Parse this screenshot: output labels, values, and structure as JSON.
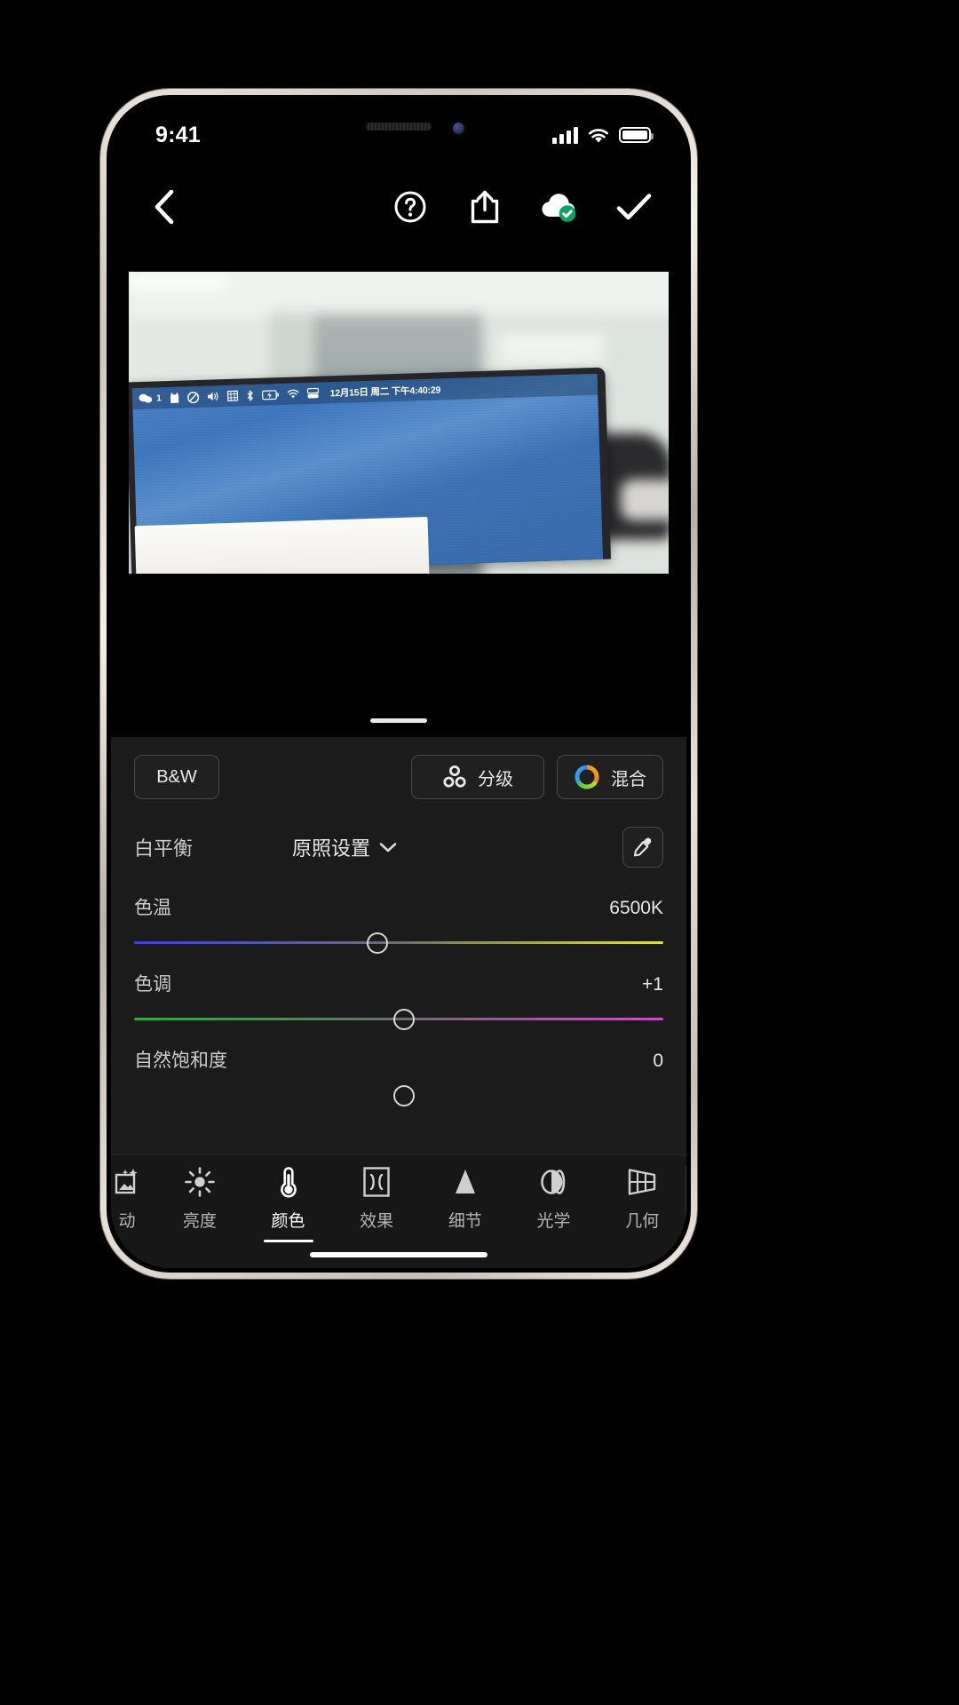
{
  "status_bar": {
    "time": "9:41",
    "signal_icon": "cellular-signal-icon",
    "wifi_icon": "wifi-icon",
    "battery_icon": "battery-icon"
  },
  "nav_bar": {
    "back_icon": "chevron-left-icon",
    "help_icon": "question-circle-icon",
    "share_icon": "share-upload-icon",
    "cloud_icon": "cloud-synced-icon",
    "done_icon": "checkmark-icon"
  },
  "photo": {
    "mac_menubar": {
      "wechat_badge": "1",
      "items": [
        "wechat-icon",
        "cat-icon",
        "display-icon",
        "volume-icon",
        "input-method-pinyin-icon",
        "bluetooth-icon",
        "battery-charging-icon",
        "wifi-icon",
        "control-center-icon"
      ],
      "clock": "12月15日 周二 下午4:40:29"
    }
  },
  "edit_panel": {
    "chips": [
      {
        "name": "bw",
        "label": "B&W",
        "icon": null
      },
      {
        "name": "grading",
        "label": "分级",
        "icon": "three-circles-icon"
      },
      {
        "name": "mixing",
        "label": "混合",
        "icon": "color-wheel-icon"
      }
    ],
    "white_balance": {
      "label": "白平衡",
      "value": "原照设置",
      "chevron_icon": "chevron-down-icon",
      "eyedropper_icon": "eyedropper-icon"
    },
    "sliders": [
      {
        "name": "temperature",
        "label": "色温",
        "value": "6500K",
        "knob_percent": 46,
        "gradient_from": "#4040d8",
        "gradient_to": "#dede4a"
      },
      {
        "name": "tint",
        "label": "色调",
        "value": "+1",
        "knob_percent": 51,
        "gradient_from": "#33aa44",
        "gradient_to": "#cc4fc8"
      },
      {
        "name": "vibrance",
        "label": "自然饱和度",
        "value": "0",
        "knob_percent": 51,
        "gradient_from": "#808080",
        "gradient_to": "#808080"
      }
    ]
  },
  "tab_bar": {
    "tabs": [
      {
        "name": "auto",
        "label": "动",
        "icon": "magic-wand-photo-icon",
        "active": false
      },
      {
        "name": "light",
        "label": "亮度",
        "icon": "sun-icon",
        "active": false
      },
      {
        "name": "color",
        "label": "颜色",
        "icon": "thermometer-icon",
        "active": true
      },
      {
        "name": "effects",
        "label": "效果",
        "icon": "vignette-frame-icon",
        "active": false
      },
      {
        "name": "detail",
        "label": "细节",
        "icon": "triangle-icon",
        "active": false
      },
      {
        "name": "optics",
        "label": "光学",
        "icon": "lens-icon",
        "active": false
      },
      {
        "name": "geometry",
        "label": "几何",
        "icon": "perspective-grid-icon",
        "active": false
      }
    ]
  }
}
